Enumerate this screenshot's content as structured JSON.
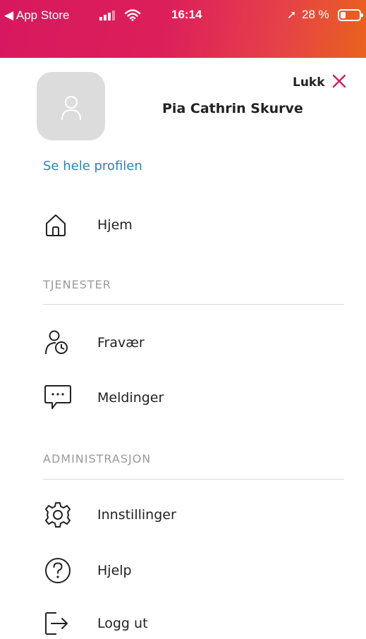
{
  "status_bar": {
    "back_label": "◀ App Store",
    "time": "16:14",
    "battery_text": "28 %",
    "battery_percent": 28,
    "location_glyph": "➚"
  },
  "header": {
    "user_name": "Pia Cathrin Skurve",
    "close_label": "Lukk",
    "profile_link": "Se hele profilen"
  },
  "menu": {
    "home": {
      "label": "Hjem",
      "icon": "home-icon"
    },
    "sections": [
      {
        "title": "TJENESTER",
        "items": [
          {
            "label": "Fravær",
            "icon": "person-clock-icon"
          },
          {
            "label": "Meldinger",
            "icon": "chat-bubble-icon"
          }
        ]
      },
      {
        "title": "ADMINISTRASJON",
        "items": [
          {
            "label": "Innstillinger",
            "icon": "gear-icon"
          },
          {
            "label": "Hjelp",
            "icon": "help-icon"
          },
          {
            "label": "Logg ut",
            "icon": "logout-icon"
          }
        ]
      }
    ]
  },
  "colors": {
    "brand_gradient_start": "#d8185e",
    "brand_gradient_end": "#e8631c",
    "close_x": "#d81a5e",
    "link": "#2b85b8"
  }
}
